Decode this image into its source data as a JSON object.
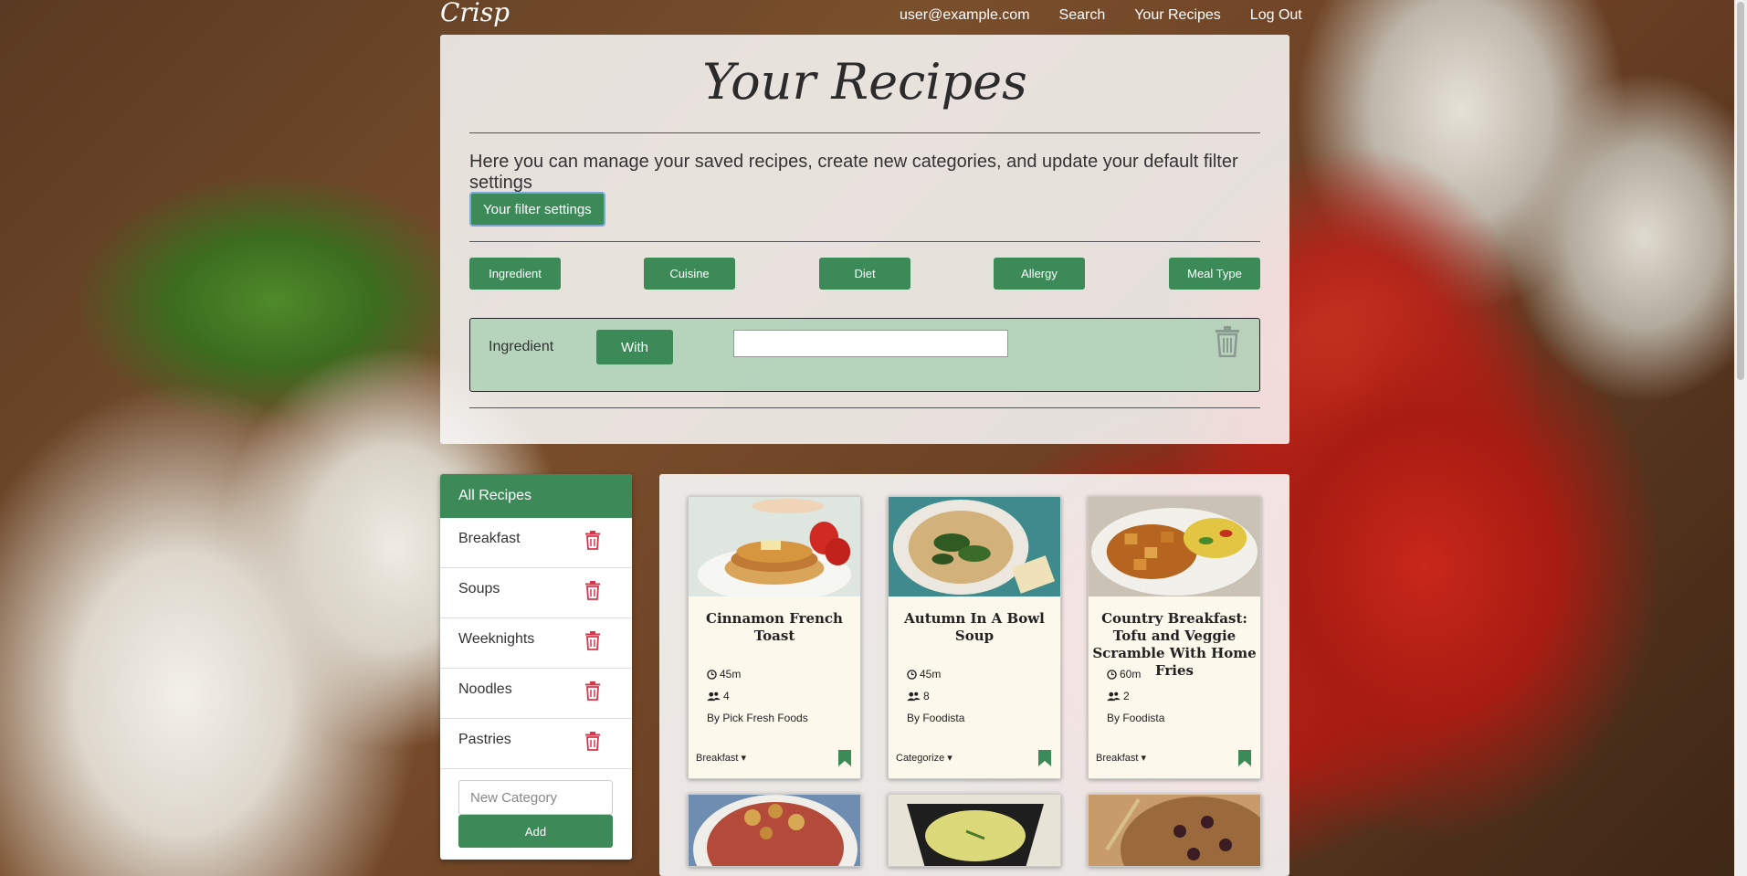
{
  "nav": {
    "brand": "Crisp",
    "user": "user@example.com",
    "search": "Search",
    "your_recipes": "Your Recipes",
    "logout": "Log Out"
  },
  "header": {
    "title": "Your Recipes",
    "intro": "Here you can manage your saved recipes, create new categories, and update your default filter settings",
    "filter_button": "Your filter settings"
  },
  "filter_tabs": [
    "Ingredient",
    "Cuisine",
    "Diet",
    "Allergy",
    "Meal Type"
  ],
  "filter_row": {
    "label": "Ingredient",
    "mode": "With",
    "value": ""
  },
  "sidebar": {
    "all": "All Recipes",
    "categories": [
      "Breakfast",
      "Soups",
      "Weeknights",
      "Noodles",
      "Pastries"
    ],
    "new_placeholder": "New Category",
    "add_label": "Add"
  },
  "recipes": [
    {
      "title": "Cinnamon French Toast",
      "time": "45m",
      "servings": "4",
      "by": "By Pick Fresh Foods",
      "category": "Breakfast"
    },
    {
      "title": "Autumn In A Bowl Soup",
      "time": "45m",
      "servings": "8",
      "by": "By Foodista",
      "category": "Categorize"
    },
    {
      "title": "Country Breakfast: Tofu and Veggie Scramble With Home Fries",
      "time": "60m",
      "servings": "2",
      "by": "By Foodista",
      "category": "Breakfast"
    }
  ],
  "colors": {
    "accent_green": "#3c8a58",
    "danger_red": "#d9344a"
  }
}
